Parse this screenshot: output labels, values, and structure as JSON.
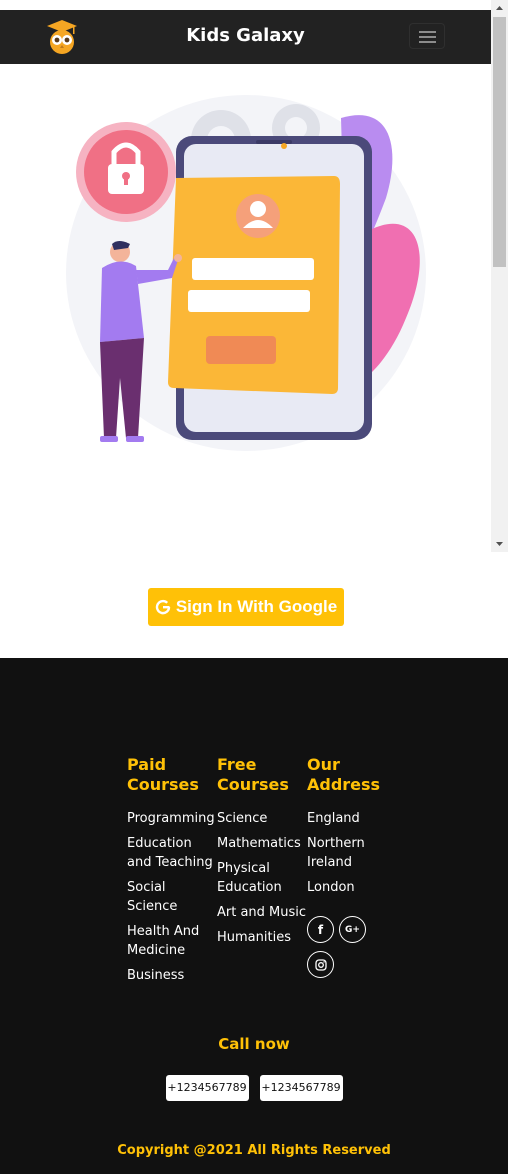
{
  "navbar": {
    "brand": "Kids Galaxy",
    "logo_icon": "owl-graduation-cap-icon",
    "toggler_icon": "hamburger-menu-icon"
  },
  "hero": {
    "illustration": "login-illustration"
  },
  "signin": {
    "label": "Sign In With Google",
    "icon": "google-g-icon"
  },
  "footer": {
    "columns": [
      {
        "title": "Paid Courses",
        "items": [
          "Programming",
          "Education and Teaching",
          "Social Science",
          "Health And Medicine",
          "Business"
        ]
      },
      {
        "title": "Free Courses",
        "items": [
          "Science",
          "Mathematics",
          "Physical Education",
          "Art and Music",
          "Humanities"
        ]
      },
      {
        "title": "Our Address",
        "items": [
          "England",
          "Northern Ireland",
          "London"
        ]
      }
    ],
    "social": {
      "facebook": "f",
      "google_plus": "G+"
    },
    "call_label": "Call now",
    "phones": [
      "+1234567789",
      "+1234567789"
    ],
    "copyright": "Copyright @2021 All Rights Reserved"
  },
  "colors": {
    "accent": "#ffc107",
    "navbar_bg": "#222222",
    "footer_bg": "#111111"
  }
}
